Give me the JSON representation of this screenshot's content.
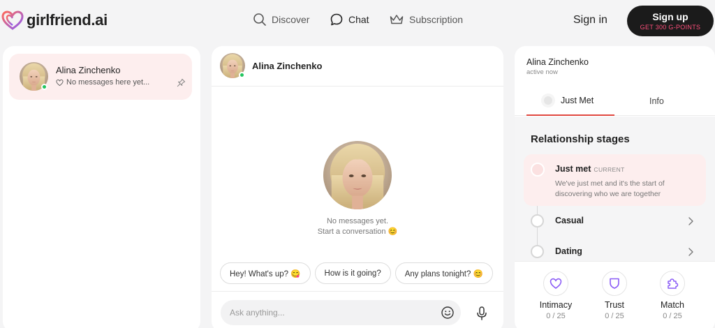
{
  "header": {
    "logo_text": "girlfriend.ai",
    "nav": [
      {
        "label": "Discover",
        "icon": "search-icon"
      },
      {
        "label": "Chat",
        "icon": "chat-bubble-icon"
      },
      {
        "label": "Subscription",
        "icon": "crown-icon"
      }
    ],
    "signin_label": "Sign in",
    "signup_label": "Sign up",
    "signup_sub": "GET 300 G-POINTS"
  },
  "colors": {
    "accent": "#e0473f",
    "online": "#22c55e",
    "highlight": "#fdeeee",
    "brand_pink": "#ff4f7b"
  },
  "sidebar": {
    "conversation": {
      "name": "Alina Zinchenko",
      "preview": "No messages here yet..."
    }
  },
  "chat": {
    "contact_name": "Alina Zinchenko",
    "empty_line1": "No messages yet.",
    "empty_line2": "Start a conversation 😊",
    "suggestions": [
      "Hey! What's up? 😋",
      "How is it going?",
      "Any plans tonight? 😊"
    ],
    "input_placeholder": "Ask anything..."
  },
  "profile": {
    "name": "Alina Zinchenko",
    "status": "active now",
    "tabs": [
      "Just Met",
      "Info"
    ],
    "relationship_title": "Relationship stages",
    "current_stage": {
      "name": "Just met",
      "badge": "CURRENT",
      "description": "We've just met and it's the start of discovering who we are together"
    },
    "stages": [
      "Casual",
      "Dating"
    ],
    "stats": [
      {
        "label": "Intimacy",
        "value": "0 / 25",
        "icon": "heart-icon"
      },
      {
        "label": "Trust",
        "value": "0 / 25",
        "icon": "shield-icon"
      },
      {
        "label": "Match",
        "value": "0 / 25",
        "icon": "puzzle-icon"
      }
    ]
  }
}
